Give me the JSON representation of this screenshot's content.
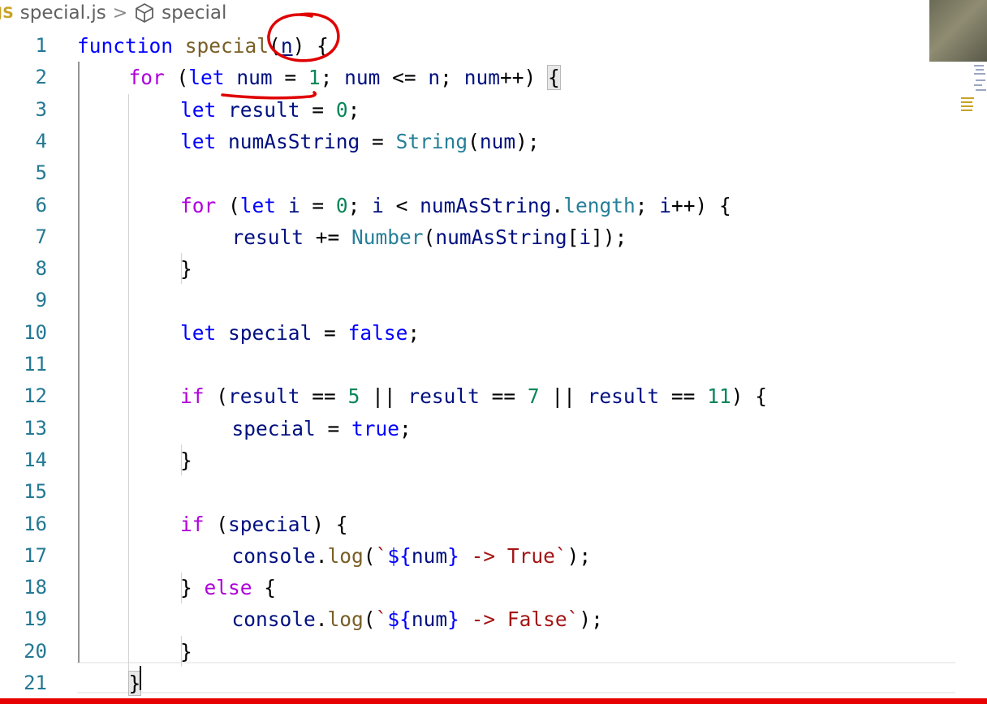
{
  "breadcrumb": {
    "file_icon": "JS",
    "file_name": "special.js",
    "separator": ">",
    "symbol_icon": "cube-icon",
    "symbol_name": "special"
  },
  "editor": {
    "line_numbers": [
      "1",
      "2",
      "3",
      "4",
      "5",
      "6",
      "7",
      "8",
      "9",
      "10",
      "11",
      "12",
      "13",
      "14",
      "15",
      "16",
      "17",
      "18",
      "19",
      "20",
      "21"
    ],
    "lines": [
      [
        {
          "t": "kw",
          "v": "function"
        },
        {
          "t": "punc",
          "v": " "
        },
        {
          "t": "fn",
          "v": "special"
        },
        {
          "t": "punc",
          "v": "("
        },
        {
          "t": "var",
          "v": "n",
          "u": true
        },
        {
          "t": "punc",
          "v": ") {"
        }
      ],
      [
        {
          "t": "ctl",
          "v": "for"
        },
        {
          "t": "punc",
          "v": " ("
        },
        {
          "t": "kw",
          "v": "let"
        },
        {
          "t": "punc",
          "v": " "
        },
        {
          "t": "var",
          "v": "num"
        },
        {
          "t": "punc",
          "v": " = "
        },
        {
          "t": "num",
          "v": "1"
        },
        {
          "t": "punc",
          "v": "; "
        },
        {
          "t": "var",
          "v": "num"
        },
        {
          "t": "punc",
          "v": " <= "
        },
        {
          "t": "var",
          "v": "n"
        },
        {
          "t": "punc",
          "v": "; "
        },
        {
          "t": "var",
          "v": "num"
        },
        {
          "t": "punc",
          "v": "++) "
        },
        {
          "t": "punc",
          "v": "{",
          "hl": true
        }
      ],
      [
        {
          "t": "kw",
          "v": "let"
        },
        {
          "t": "punc",
          "v": " "
        },
        {
          "t": "var",
          "v": "result"
        },
        {
          "t": "punc",
          "v": " = "
        },
        {
          "t": "num",
          "v": "0"
        },
        {
          "t": "punc",
          "v": ";"
        }
      ],
      [
        {
          "t": "kw",
          "v": "let"
        },
        {
          "t": "punc",
          "v": " "
        },
        {
          "t": "var",
          "v": "numAsString"
        },
        {
          "t": "punc",
          "v": " = "
        },
        {
          "t": "type",
          "v": "String"
        },
        {
          "t": "punc",
          "v": "("
        },
        {
          "t": "var",
          "v": "num"
        },
        {
          "t": "punc",
          "v": ");"
        }
      ],
      [],
      [
        {
          "t": "ctl",
          "v": "for"
        },
        {
          "t": "punc",
          "v": " ("
        },
        {
          "t": "kw",
          "v": "let"
        },
        {
          "t": "punc",
          "v": " "
        },
        {
          "t": "var",
          "v": "i"
        },
        {
          "t": "punc",
          "v": " = "
        },
        {
          "t": "num",
          "v": "0"
        },
        {
          "t": "punc",
          "v": "; "
        },
        {
          "t": "var",
          "v": "i"
        },
        {
          "t": "punc",
          "v": " < "
        },
        {
          "t": "var",
          "v": "numAsString"
        },
        {
          "t": "punc",
          "v": "."
        },
        {
          "t": "type",
          "v": "length"
        },
        {
          "t": "punc",
          "v": "; "
        },
        {
          "t": "var",
          "v": "i"
        },
        {
          "t": "punc",
          "v": "++) {"
        }
      ],
      [
        {
          "t": "var",
          "v": "result"
        },
        {
          "t": "punc",
          "v": " += "
        },
        {
          "t": "type",
          "v": "Number"
        },
        {
          "t": "punc",
          "v": "("
        },
        {
          "t": "var",
          "v": "numAsString"
        },
        {
          "t": "punc",
          "v": "["
        },
        {
          "t": "var",
          "v": "i"
        },
        {
          "t": "punc",
          "v": "]);"
        }
      ],
      [
        {
          "t": "punc",
          "v": "}"
        }
      ],
      [],
      [
        {
          "t": "kw",
          "v": "let"
        },
        {
          "t": "punc",
          "v": " "
        },
        {
          "t": "var",
          "v": "special"
        },
        {
          "t": "punc",
          "v": " = "
        },
        {
          "t": "kw",
          "v": "false"
        },
        {
          "t": "punc",
          "v": ";"
        }
      ],
      [],
      [
        {
          "t": "ctl",
          "v": "if"
        },
        {
          "t": "punc",
          "v": " ("
        },
        {
          "t": "var",
          "v": "result"
        },
        {
          "t": "punc",
          "v": " == "
        },
        {
          "t": "num",
          "v": "5"
        },
        {
          "t": "punc",
          "v": " || "
        },
        {
          "t": "var",
          "v": "result"
        },
        {
          "t": "punc",
          "v": " == "
        },
        {
          "t": "num",
          "v": "7"
        },
        {
          "t": "punc",
          "v": " || "
        },
        {
          "t": "var",
          "v": "result"
        },
        {
          "t": "punc",
          "v": " == "
        },
        {
          "t": "num",
          "v": "11"
        },
        {
          "t": "punc",
          "v": ") {"
        }
      ],
      [
        {
          "t": "var",
          "v": "special"
        },
        {
          "t": "punc",
          "v": " = "
        },
        {
          "t": "kw",
          "v": "true"
        },
        {
          "t": "punc",
          "v": ";"
        }
      ],
      [
        {
          "t": "punc",
          "v": "}"
        }
      ],
      [],
      [
        {
          "t": "ctl",
          "v": "if"
        },
        {
          "t": "punc",
          "v": " ("
        },
        {
          "t": "var",
          "v": "special"
        },
        {
          "t": "punc",
          "v": ") {"
        }
      ],
      [
        {
          "t": "var",
          "v": "console"
        },
        {
          "t": "punc",
          "v": "."
        },
        {
          "t": "fn",
          "v": "log"
        },
        {
          "t": "punc",
          "v": "("
        },
        {
          "t": "str",
          "v": "`"
        },
        {
          "t": "kw",
          "v": "${"
        },
        {
          "t": "var",
          "v": "num"
        },
        {
          "t": "kw",
          "v": "}"
        },
        {
          "t": "str",
          "v": " -> True`"
        },
        {
          "t": "punc",
          "v": ");"
        }
      ],
      [
        {
          "t": "punc",
          "v": "} "
        },
        {
          "t": "ctl",
          "v": "else"
        },
        {
          "t": "punc",
          "v": " {"
        }
      ],
      [
        {
          "t": "var",
          "v": "console"
        },
        {
          "t": "punc",
          "v": "."
        },
        {
          "t": "fn",
          "v": "log"
        },
        {
          "t": "punc",
          "v": "("
        },
        {
          "t": "str",
          "v": "`"
        },
        {
          "t": "kw",
          "v": "${"
        },
        {
          "t": "var",
          "v": "num"
        },
        {
          "t": "kw",
          "v": "}"
        },
        {
          "t": "str",
          "v": " -> False`"
        },
        {
          "t": "punc",
          "v": ");"
        }
      ],
      [
        {
          "t": "punc",
          "v": "}"
        }
      ],
      [
        {
          "t": "punc",
          "v": "}",
          "hl": true
        }
      ]
    ]
  },
  "colors": {
    "keyword": "#0000ff",
    "control": "#af00db",
    "variable": "#001080",
    "function": "#795e26",
    "type": "#267f99",
    "number": "#098658",
    "string": "#a31515",
    "line_number": "#237893",
    "annotation": "#e00000",
    "progress": "#e60000"
  },
  "icons": {
    "file": "js-file-icon",
    "symbol": "cube-icon"
  }
}
